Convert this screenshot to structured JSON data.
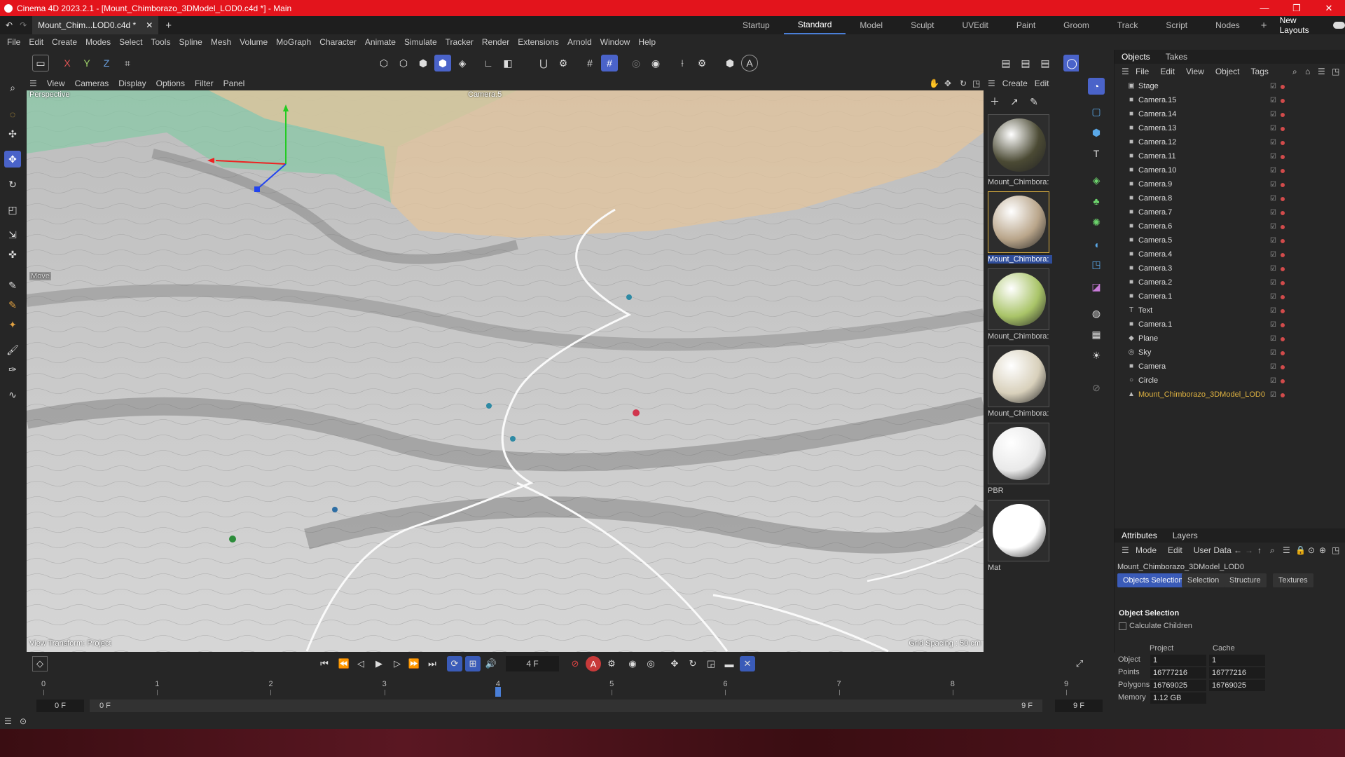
{
  "window": {
    "title": "Cinema 4D 2023.2.1 - [Mount_Chimborazo_3DModel_LOD0.c4d *] - Main",
    "controls": [
      "—",
      "❐",
      "✕"
    ]
  },
  "doc_tab": {
    "label": "Mount_Chim...LOD0.c4d *",
    "close": "✕",
    "add": "+"
  },
  "layouts": [
    "Startup",
    "Standard",
    "Model",
    "Sculpt",
    "UVEdit",
    "Paint",
    "Groom",
    "Track",
    "Script",
    "Nodes"
  ],
  "layouts_active": "Standard",
  "layouts_add": "+",
  "new_layouts": "New Layouts",
  "menu": [
    "File",
    "Edit",
    "Create",
    "Modes",
    "Select",
    "Tools",
    "Spline",
    "Mesh",
    "Volume",
    "MoGraph",
    "Character",
    "Animate",
    "Simulate",
    "Tracker",
    "Render",
    "Extensions",
    "Arnold",
    "Window",
    "Help"
  ],
  "axis_lock": {
    "x": "X",
    "y": "Y",
    "z": "Z"
  },
  "viewport": {
    "menu": [
      "View",
      "Cameras",
      "Display",
      "Options",
      "Filter",
      "Panel"
    ],
    "perspective": "Perspective",
    "camera": "Camera.5",
    "tool": "Move",
    "transform": "View Transform: Project",
    "grid": "Grid Spacing : 50 cm"
  },
  "materials": {
    "menu": [
      "Create",
      "Edit"
    ],
    "items": [
      {
        "name": "Mount_Chimbora:",
        "color": "#4b4a34"
      },
      {
        "name": "Mount_Chimbora:",
        "color": "#b9a58a"
      },
      {
        "name": "Mount_Chimbora:",
        "color": "#a9c468"
      },
      {
        "name": "Mount_Chimbora:",
        "color": "#d8d0bb"
      },
      {
        "name": "PBR",
        "color": "#e9e9e9"
      },
      {
        "name": "Mat",
        "color": "#ffffff"
      }
    ]
  },
  "objects_panel": {
    "tabs": [
      "Objects",
      "Takes"
    ],
    "menu": [
      "File",
      "Edit",
      "View",
      "Object",
      "Tags"
    ],
    "rows": [
      {
        "name": "Stage",
        "icon": "▣"
      },
      {
        "name": "Camera.15",
        "icon": "■"
      },
      {
        "name": "Camera.14",
        "icon": "■"
      },
      {
        "name": "Camera.13",
        "icon": "■"
      },
      {
        "name": "Camera.12",
        "icon": "■"
      },
      {
        "name": "Camera.11",
        "icon": "■"
      },
      {
        "name": "Camera.10",
        "icon": "■"
      },
      {
        "name": "Camera.9",
        "icon": "■"
      },
      {
        "name": "Camera.8",
        "icon": "■"
      },
      {
        "name": "Camera.7",
        "icon": "■"
      },
      {
        "name": "Camera.6",
        "icon": "■"
      },
      {
        "name": "Camera.5",
        "icon": "■"
      },
      {
        "name": "Camera.4",
        "icon": "■"
      },
      {
        "name": "Camera.3",
        "icon": "■"
      },
      {
        "name": "Camera.2",
        "icon": "■"
      },
      {
        "name": "Camera.1",
        "icon": "■"
      },
      {
        "name": "Text",
        "icon": "T"
      },
      {
        "name": "Camera.1",
        "icon": "■"
      },
      {
        "name": "Plane",
        "icon": "◆"
      },
      {
        "name": "Sky",
        "icon": "◎"
      },
      {
        "name": "Camera",
        "icon": "■"
      },
      {
        "name": "Circle",
        "icon": "○"
      },
      {
        "name": "Mount_Chimborazo_3DModel_LOD0",
        "icon": "▲"
      }
    ]
  },
  "attributes": {
    "tabs": [
      "Attributes",
      "Layers"
    ],
    "menu": [
      "Mode",
      "Edit",
      "User Data"
    ],
    "object_name": "Mount_Chimborazo_3DModel_LOD0",
    "subtabs": [
      "Objects Selection",
      "Selection",
      "Structure",
      "Textures"
    ],
    "section": "Object Selection",
    "calc_children": "Calculate Children",
    "col_project": "Project",
    "col_cache": "Cache",
    "rows": [
      {
        "label": "Object",
        "project": "1",
        "cache": "1"
      },
      {
        "label": "Points",
        "project": "16777216",
        "cache": "16777216"
      },
      {
        "label": "Polygons",
        "project": "16769025",
        "cache": "16769025"
      },
      {
        "label": "Memory",
        "project": "1.12 GB",
        "cache": ""
      }
    ]
  },
  "timeline": {
    "frame": "4 F",
    "ticks": [
      "0",
      "1",
      "2",
      "3",
      "4",
      "5",
      "6",
      "7",
      "8",
      "9"
    ],
    "current": 4,
    "start": "0 F",
    "start2": "0 F",
    "end": "9 F",
    "end2": "9 F"
  }
}
